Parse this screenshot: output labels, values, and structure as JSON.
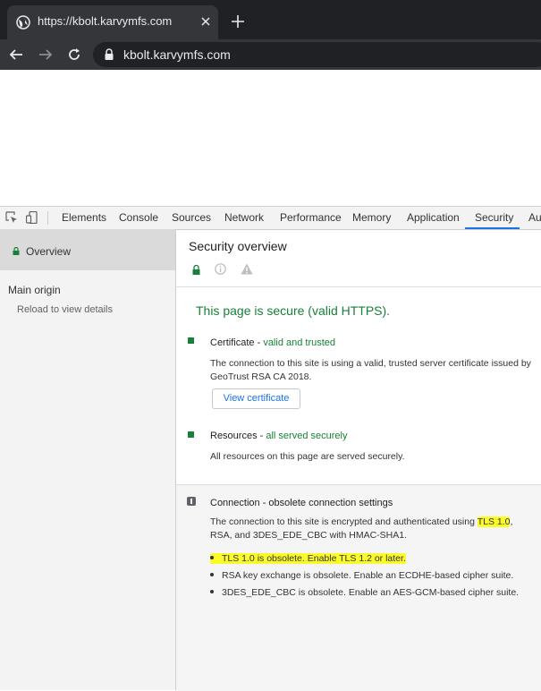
{
  "browser": {
    "tab_title": "https://kbolt.karvymfs.com",
    "url": "kbolt.karvymfs.com"
  },
  "devtools": {
    "tabs": [
      "Elements",
      "Console",
      "Sources",
      "Network",
      "Performance",
      "Memory",
      "Application",
      "Security",
      "Aud"
    ],
    "active_tab": "Security"
  },
  "sidebar": {
    "overview_label": "Overview",
    "main_origin_heading": "Main origin",
    "reload_hint": "Reload to view details"
  },
  "overview": {
    "title": "Security overview",
    "secure_message": "This page is secure (valid HTTPS).",
    "certificate": {
      "label": "Certificate",
      "status": "valid and trusted",
      "description": "The connection to this site is using a valid, trusted server certificate issued by GeoTrust RSA CA 2018.",
      "button": "View certificate"
    },
    "resources": {
      "label": "Resources",
      "status": "all served securely",
      "description": "All resources on this page are served securely."
    },
    "connection": {
      "title": "Connection - obsolete connection settings",
      "desc_prefix": "The connection to this site is encrypted and authenticated using",
      "desc_highlight": "TLS 1.0",
      "desc_suffix": ", RSA, and 3DES_EDE_CBC with HMAC-SHA1.",
      "issues": [
        "TLS 1.0 is obsolete. Enable TLS 1.2 or later.",
        "RSA key exchange is obsolete. Enable an ECDHE-based cipher suite.",
        "3DES_EDE_CBC is obsolete. Enable an AES-GCM-based cipher suite."
      ]
    }
  },
  "colors": {
    "secure_green": "#188038",
    "link_blue": "#1a73e8",
    "highlight": "#fbfb2a",
    "chrome_dark": "#202124"
  }
}
